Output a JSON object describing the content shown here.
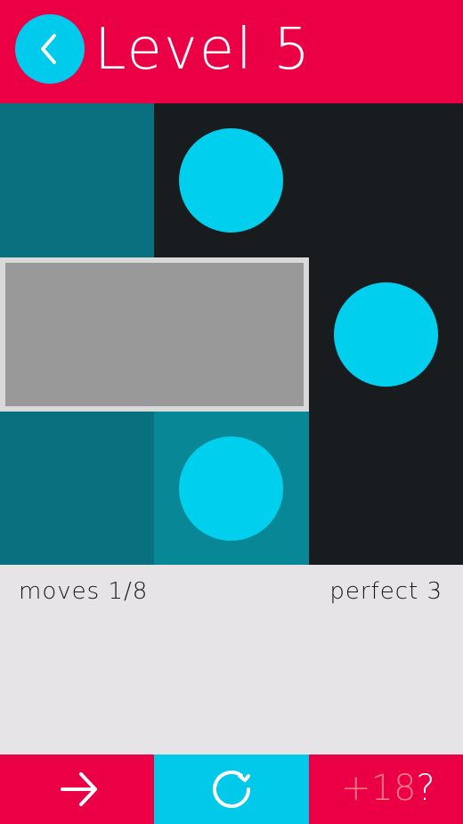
{
  "header": {
    "title": "Level 5",
    "back_icon": "chevron-left-icon"
  },
  "colors": {
    "accent_red": "#eb0045",
    "accent_cyan": "#00cbec",
    "dot": "#00cfee",
    "tile_dark_teal": "#09707f",
    "tile_mid_teal": "#088796",
    "tile_black": "#181c1f",
    "block_gray": "#999999"
  },
  "board": {
    "grid": "3x3",
    "tiles": [
      "teal",
      "black",
      "black",
      "block",
      "block",
      "black",
      "teal",
      "teal",
      "black"
    ],
    "dots_count": 3
  },
  "stats": {
    "moves": "moves 1/8",
    "perfect": "perfect 3"
  },
  "bottom_bar": {
    "next_icon": "arrow-right-icon",
    "restart_icon": "restart-icon",
    "hint_count": "+18",
    "hint_q": "?"
  }
}
